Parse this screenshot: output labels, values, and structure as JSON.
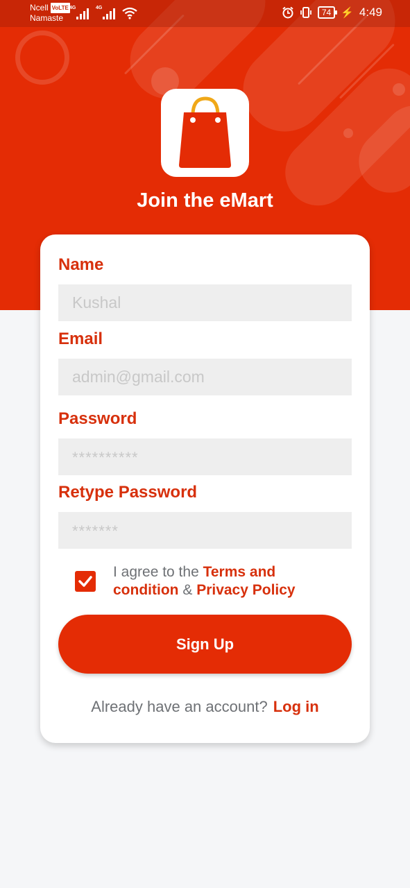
{
  "status_bar": {
    "carrier": "Ncell",
    "volte": "VoLTE",
    "network_name": "Namaste",
    "net1": "4G",
    "net2": "4G",
    "battery": "74",
    "time": "4:49"
  },
  "header": {
    "title": "Join the eMart",
    "colors": {
      "brand": "#e42c05",
      "accent_text": "#d7300c",
      "bag_handle": "#f0a818"
    }
  },
  "form": {
    "name": {
      "label": "Name",
      "placeholder": "Kushal"
    },
    "email": {
      "label": "Email",
      "placeholder": "admin@gmail.com"
    },
    "password": {
      "label": "Password",
      "placeholder": "**********"
    },
    "retype_password": {
      "label": "Retype Password",
      "placeholder": "*******"
    },
    "agreement": {
      "checked": true,
      "prefix": "I agree to the",
      "terms": "Terms and condition",
      "and": "&",
      "privacy": "Privacy Policy"
    },
    "signup_label": "Sign Up",
    "login_prompt": "Already have an account?",
    "login_link": "Log in"
  }
}
